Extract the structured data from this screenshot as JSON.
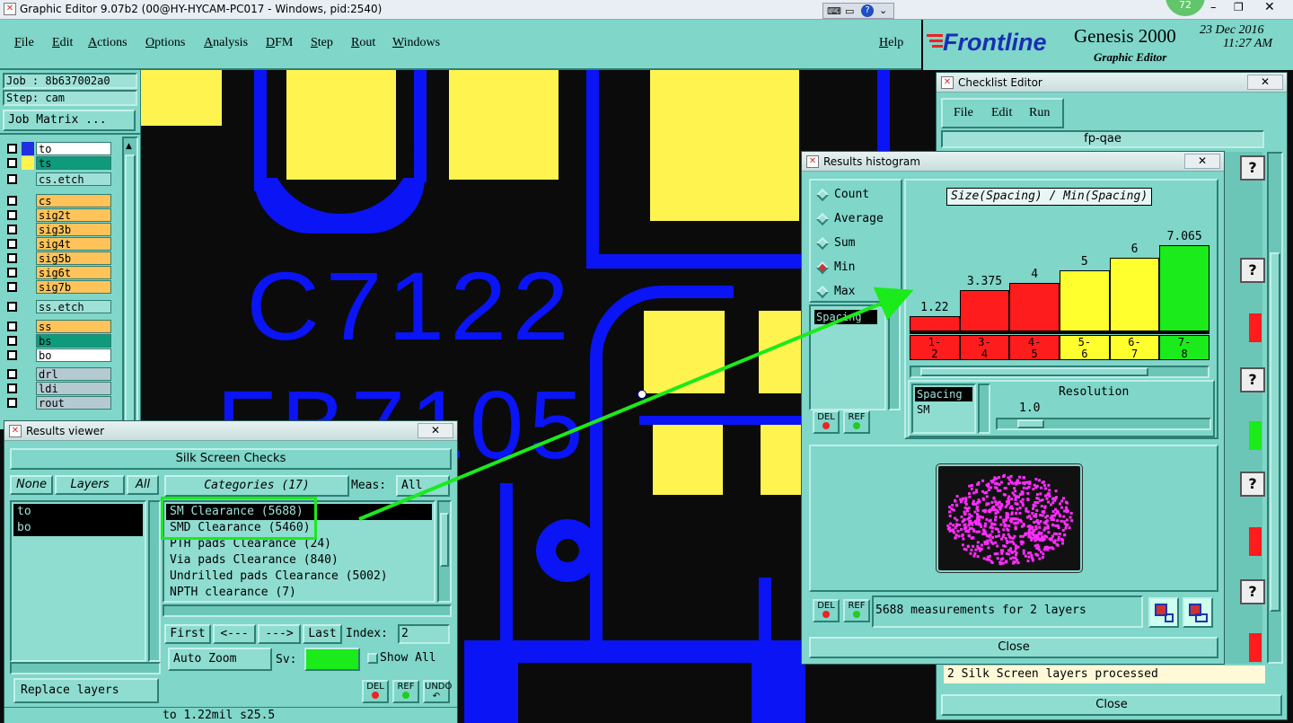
{
  "window": {
    "title": "Graphic Editor 9.07b2 (00@HY-HYCAM-PC017 - Windows, pid:2540)",
    "badge": "72"
  },
  "menu": [
    "File",
    "Edit",
    "Actions",
    "Options",
    "Analysis",
    "DFM",
    "Step",
    "Rout",
    "Windows"
  ],
  "help": "Help",
  "brand": {
    "logo": "Frontline",
    "product": "Genesis 2000",
    "subtitle": "Graphic Editor",
    "date": "23 Dec 2016",
    "time": "11:27 AM"
  },
  "job": {
    "job_label": "Job : 8b637002a0",
    "step_label": "Step: cam",
    "matrix_button": "Job Matrix ..."
  },
  "layers": [
    {
      "name": "to",
      "color": "#ffffff"
    },
    {
      "name": "ts",
      "color": "#0e9b7c"
    },
    {
      "name": "cs.etch",
      "color": "#9fe1d7"
    },
    {
      "name": "cs",
      "color": "#ffc35a"
    },
    {
      "name": "sig2t",
      "color": "#ffc35a"
    },
    {
      "name": "sig3b",
      "color": "#ffc35a"
    },
    {
      "name": "sig4t",
      "color": "#ffc35a"
    },
    {
      "name": "sig5b",
      "color": "#ffc35a"
    },
    {
      "name": "sig6t",
      "color": "#ffc35a"
    },
    {
      "name": "sig7b",
      "color": "#ffc35a"
    },
    {
      "name": "ss.etch",
      "color": "#9fe1d7"
    },
    {
      "name": "ss",
      "color": "#ffc35a"
    },
    {
      "name": "bs",
      "color": "#0e9b7c"
    },
    {
      "name": "bo",
      "color": "#ffffff"
    },
    {
      "name": "drl",
      "color": "#b5c9d1"
    },
    {
      "name": "ldi",
      "color": "#b5c9d1"
    },
    {
      "name": "rout",
      "color": "#b5c9d1"
    }
  ],
  "pcb": {
    "label1": "C7122",
    "label2": "FB7105"
  },
  "results_viewer": {
    "title": "Results viewer",
    "header": "Silk Screen Checks",
    "none_btn": "None",
    "layers_btn": "Layers",
    "all_btn": "All",
    "categories_btn": "Categories (17)",
    "meas_label": "Meas:",
    "meas_value": "All",
    "layer_list": [
      "to",
      "bo"
    ],
    "categories": [
      "SM Clearance (5688)",
      "SMD Clearance (5460)",
      "PTH pads Clearance (24)",
      "Via pads Clearance (840)",
      "Undrilled pads Clearance (5002)",
      "NPTH clearance (7)"
    ],
    "first": "First",
    "prev": "<---",
    "next": "--->",
    "last": "Last",
    "index_label": "Index:",
    "index_value": "2",
    "auto_zoom": "Auto Zoom",
    "sv_label": "Sv:",
    "show_all": "Show All",
    "replace_layers": "Replace layers",
    "del": "DEL",
    "ref": "REF",
    "undo": "UNDO",
    "status": "to 1.22mil  s25.5"
  },
  "checklist_editor": {
    "title": "Checklist Editor",
    "menu": [
      "File",
      "Edit",
      "Run"
    ],
    "name": "fp-qae",
    "status": "2 Silk Screen layers processed",
    "close": "Close"
  },
  "histogram": {
    "title": "Results histogram",
    "options": [
      {
        "label": "Count",
        "on": false
      },
      {
        "label": "Average",
        "on": false
      },
      {
        "label": "Sum",
        "on": false
      },
      {
        "label": "Min",
        "on": true
      },
      {
        "label": "Max",
        "on": false
      }
    ],
    "field_label": "Spacing",
    "del": "DEL",
    "ref": "REF",
    "panel_label": "Spacing",
    "panel_value": "SM",
    "resolution_label": "Resolution",
    "resolution_value": "1.0",
    "measurements": "5688 measurements for 2 layers",
    "close": "Close"
  },
  "chart_data": {
    "type": "bar",
    "title": "Size(Spacing) / Min(Spacing)",
    "categories": [
      "1-2",
      "3-4",
      "4-5",
      "5-6",
      "6-7",
      "7-8"
    ],
    "values": [
      1.22,
      3.375,
      4,
      5,
      6,
      7.065
    ],
    "value_labels": [
      "1.22",
      "3.375",
      "4",
      "5",
      "6",
      "7.065"
    ],
    "colors": [
      "#ff1c1c",
      "#ff1c1c",
      "#ff1c1c",
      "#ffff2e",
      "#ffff2e",
      "#1bea1b"
    ],
    "ylim": [
      0,
      7.065
    ]
  }
}
